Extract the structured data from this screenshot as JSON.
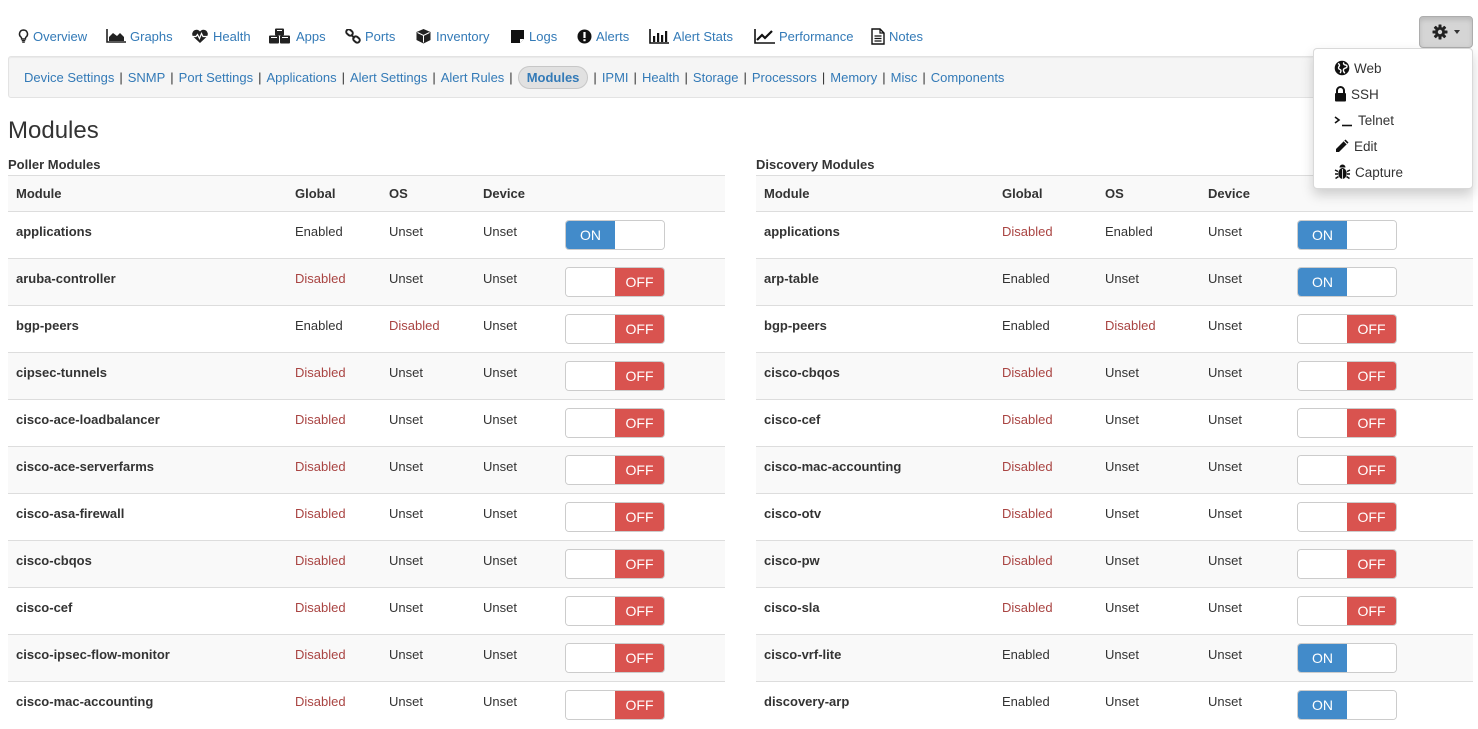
{
  "topnav": {
    "items": [
      {
        "label": "Overview",
        "icon": "lightbulb-icon"
      },
      {
        "label": "Graphs",
        "icon": "area-chart-icon"
      },
      {
        "label": "Health",
        "icon": "heartbeat-icon"
      },
      {
        "label": "Apps",
        "icon": "cubes-icon"
      },
      {
        "label": "Ports",
        "icon": "link-icon"
      },
      {
        "label": "Inventory",
        "icon": "cube-icon"
      },
      {
        "label": "Logs",
        "icon": "sticky-note-icon"
      },
      {
        "label": "Alerts",
        "icon": "exclamation-circle-icon"
      },
      {
        "label": "Alert Stats",
        "icon": "bar-chart-icon"
      },
      {
        "label": "Performance",
        "icon": "line-chart-icon"
      },
      {
        "label": "Notes",
        "icon": "file-text-icon"
      }
    ],
    "gear_menu": {
      "icon": "gear-icon",
      "items": [
        {
          "label": "Web",
          "icon": "globe-icon"
        },
        {
          "label": "SSH",
          "icon": "lock-icon"
        },
        {
          "label": "Telnet",
          "icon": "terminal-icon"
        },
        {
          "label": "Edit",
          "icon": "pencil-icon"
        },
        {
          "label": "Capture",
          "icon": "bug-icon"
        }
      ]
    }
  },
  "subnav": {
    "items": [
      "Device Settings",
      "SNMP",
      "Port Settings",
      "Applications",
      "Alert Settings",
      "Alert Rules",
      "Modules",
      "IPMI",
      "Health",
      "Storage",
      "Processors",
      "Memory",
      "Misc",
      "Components"
    ],
    "active": "Modules"
  },
  "page_title": "Modules",
  "colors": {
    "on": "#428bca",
    "off": "#d9534f",
    "disabled_text": "#a94442",
    "link": "#337ab7"
  },
  "poller": {
    "title": "Poller Modules",
    "headers": [
      "Module",
      "Global",
      "OS",
      "Device"
    ],
    "rows": [
      {
        "module": "applications",
        "global": "Enabled",
        "os": "Unset",
        "device": "Unset",
        "state": "ON"
      },
      {
        "module": "aruba-controller",
        "global": "Disabled",
        "os": "Unset",
        "device": "Unset",
        "state": "OFF"
      },
      {
        "module": "bgp-peers",
        "global": "Enabled",
        "os": "Disabled",
        "device": "Unset",
        "state": "OFF"
      },
      {
        "module": "cipsec-tunnels",
        "global": "Disabled",
        "os": "Unset",
        "device": "Unset",
        "state": "OFF"
      },
      {
        "module": "cisco-ace-loadbalancer",
        "global": "Disabled",
        "os": "Unset",
        "device": "Unset",
        "state": "OFF"
      },
      {
        "module": "cisco-ace-serverfarms",
        "global": "Disabled",
        "os": "Unset",
        "device": "Unset",
        "state": "OFF"
      },
      {
        "module": "cisco-asa-firewall",
        "global": "Disabled",
        "os": "Unset",
        "device": "Unset",
        "state": "OFF"
      },
      {
        "module": "cisco-cbqos",
        "global": "Disabled",
        "os": "Unset",
        "device": "Unset",
        "state": "OFF"
      },
      {
        "module": "cisco-cef",
        "global": "Disabled",
        "os": "Unset",
        "device": "Unset",
        "state": "OFF"
      },
      {
        "module": "cisco-ipsec-flow-monitor",
        "global": "Disabled",
        "os": "Unset",
        "device": "Unset",
        "state": "OFF"
      },
      {
        "module": "cisco-mac-accounting",
        "global": "Disabled",
        "os": "Unset",
        "device": "Unset",
        "state": "OFF"
      }
    ]
  },
  "discovery": {
    "title": "Discovery Modules",
    "headers": [
      "Module",
      "Global",
      "OS",
      "Device"
    ],
    "rows": [
      {
        "module": "applications",
        "global": "Disabled",
        "os": "Enabled",
        "device": "Unset",
        "state": "ON"
      },
      {
        "module": "arp-table",
        "global": "Enabled",
        "os": "Unset",
        "device": "Unset",
        "state": "ON"
      },
      {
        "module": "bgp-peers",
        "global": "Enabled",
        "os": "Disabled",
        "device": "Unset",
        "state": "OFF"
      },
      {
        "module": "cisco-cbqos",
        "global": "Disabled",
        "os": "Unset",
        "device": "Unset",
        "state": "OFF"
      },
      {
        "module": "cisco-cef",
        "global": "Disabled",
        "os": "Unset",
        "device": "Unset",
        "state": "OFF"
      },
      {
        "module": "cisco-mac-accounting",
        "global": "Disabled",
        "os": "Unset",
        "device": "Unset",
        "state": "OFF"
      },
      {
        "module": "cisco-otv",
        "global": "Disabled",
        "os": "Unset",
        "device": "Unset",
        "state": "OFF"
      },
      {
        "module": "cisco-pw",
        "global": "Disabled",
        "os": "Unset",
        "device": "Unset",
        "state": "OFF"
      },
      {
        "module": "cisco-sla",
        "global": "Disabled",
        "os": "Unset",
        "device": "Unset",
        "state": "OFF"
      },
      {
        "module": "cisco-vrf-lite",
        "global": "Enabled",
        "os": "Unset",
        "device": "Unset",
        "state": "ON"
      },
      {
        "module": "discovery-arp",
        "global": "Enabled",
        "os": "Unset",
        "device": "Unset",
        "state": "ON"
      }
    ]
  }
}
